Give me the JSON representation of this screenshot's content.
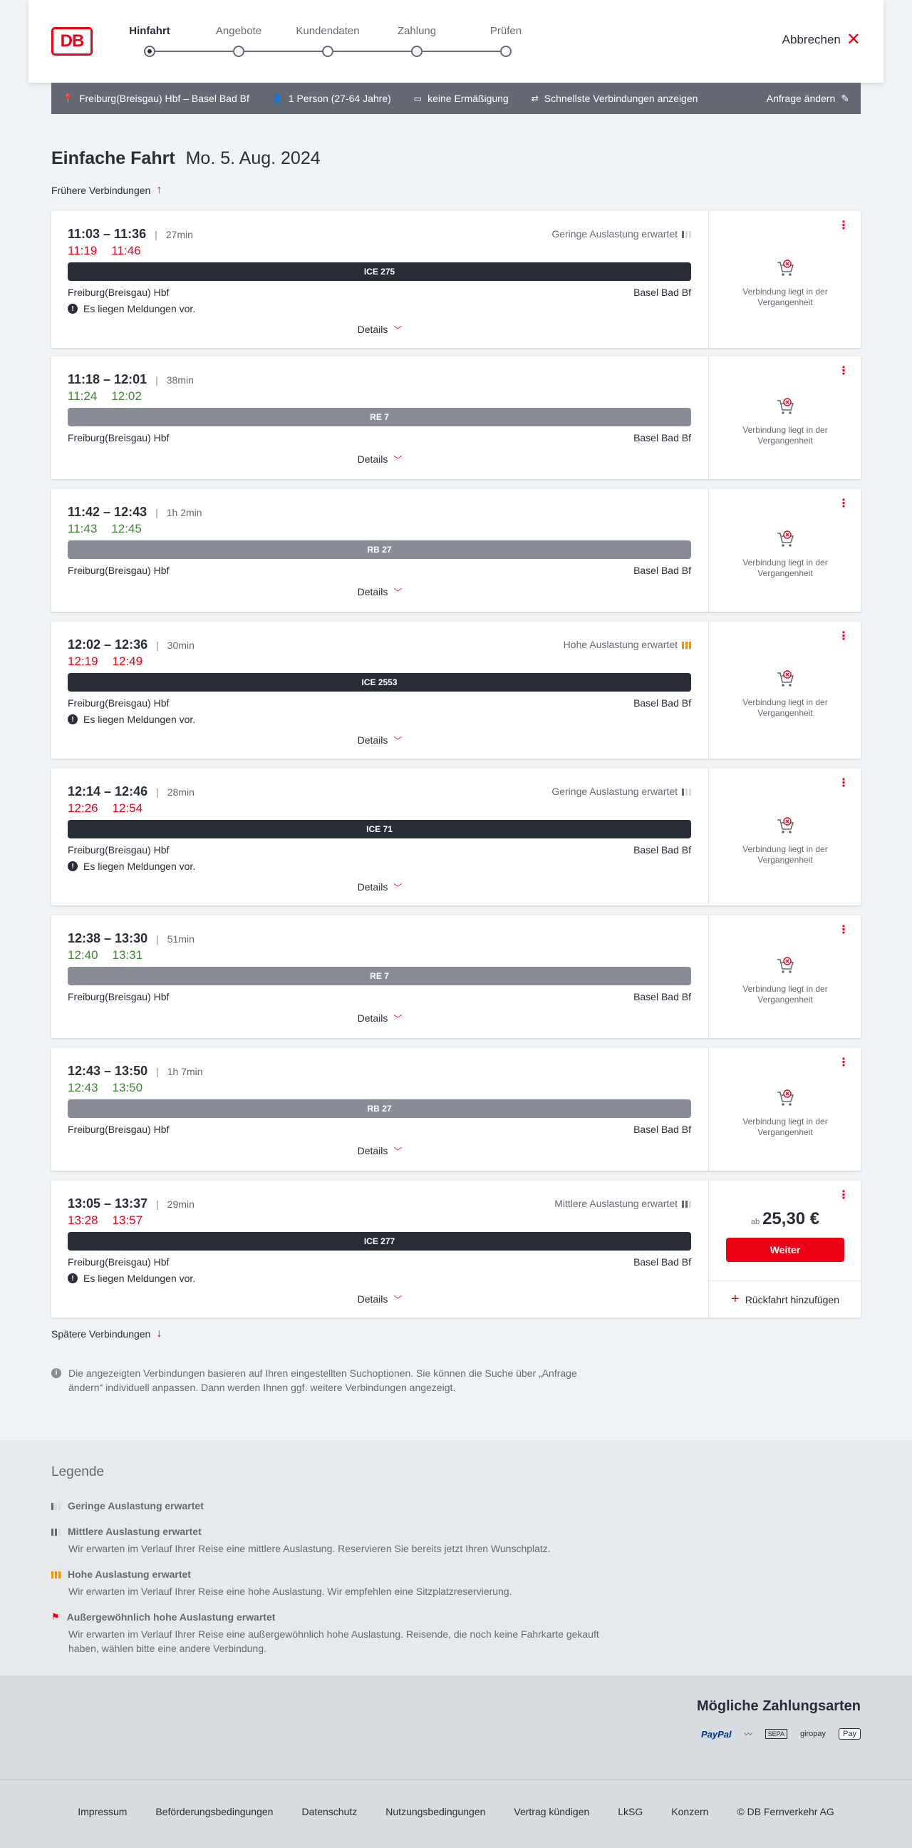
{
  "header": {
    "logo": "DB",
    "steps": [
      "Hinfahrt",
      "Angebote",
      "Kundendaten",
      "Zahlung",
      "Prüfen"
    ],
    "cancel": "Abbrechen"
  },
  "searchbar": {
    "route": "Freiburg(Breisgau) Hbf – Basel Bad Bf",
    "persons": "1 Person (27-64 Jahre)",
    "discount": "keine Ermäßigung",
    "fastest": "Schnellste Verbindungen anzeigen",
    "change": "Anfrage ändern"
  },
  "title": {
    "bold": "Einfache Fahrt",
    "date": "Mo. 5. Aug. 2024"
  },
  "earlier": "Frühere Verbindungen",
  "later": "Spätere Verbindungen",
  "details_label": "Details",
  "past_text_1": "Verbindung liegt in der",
  "past_text_2": "Vergangenheit",
  "messages_text": "Es liegen Meldungen vor.",
  "connections": [
    {
      "times": "11:03 – 11:36",
      "duration": "27min",
      "rt_dep": "11:19",
      "rt_arr": "11:46",
      "rt_state": "late",
      "load": "Geringe Auslastung erwartet",
      "load_level": "low",
      "train": "ICE 275",
      "type": "ice",
      "from": "Freiburg(Breisgau) Hbf",
      "to": "Basel Bad Bf",
      "messages": true
    },
    {
      "times": "11:18 – 12:01",
      "duration": "38min",
      "rt_dep": "11:24",
      "rt_arr": "12:02",
      "rt_state": "ontime",
      "load": "",
      "load_level": "",
      "train": "RE 7",
      "type": "reg",
      "from": "Freiburg(Breisgau) Hbf",
      "to": "Basel Bad Bf",
      "messages": false
    },
    {
      "times": "11:42 – 12:43",
      "duration": "1h 2min",
      "rt_dep": "11:43",
      "rt_arr": "12:45",
      "rt_state": "ontime",
      "load": "",
      "load_level": "",
      "train": "RB 27",
      "type": "reg",
      "from": "Freiburg(Breisgau) Hbf",
      "to": "Basel Bad Bf",
      "messages": false
    },
    {
      "times": "12:02 – 12:36",
      "duration": "30min",
      "rt_dep": "12:19",
      "rt_arr": "12:49",
      "rt_state": "late",
      "load": "Hohe Auslastung erwartet",
      "load_level": "high",
      "train": "ICE 2553",
      "type": "ice",
      "from": "Freiburg(Breisgau) Hbf",
      "to": "Basel Bad Bf",
      "messages": true
    },
    {
      "times": "12:14 – 12:46",
      "duration": "28min",
      "rt_dep": "12:26",
      "rt_arr": "12:54",
      "rt_state": "late",
      "load": "Geringe Auslastung erwartet",
      "load_level": "low",
      "train": "ICE 71",
      "type": "ice",
      "from": "Freiburg(Breisgau) Hbf",
      "to": "Basel Bad Bf",
      "messages": true
    },
    {
      "times": "12:38 – 13:30",
      "duration": "51min",
      "rt_dep": "12:40",
      "rt_arr": "13:31",
      "rt_state": "ontime",
      "load": "",
      "load_level": "",
      "train": "RE 7",
      "type": "reg",
      "from": "Freiburg(Breisgau) Hbf",
      "to": "Basel Bad Bf",
      "messages": false
    },
    {
      "times": "12:43 – 13:50",
      "duration": "1h 7min",
      "rt_dep": "12:43",
      "rt_arr": "13:50",
      "rt_state": "ontime",
      "load": "",
      "load_level": "",
      "train": "RB 27",
      "type": "reg",
      "from": "Freiburg(Breisgau) Hbf",
      "to": "Basel Bad Bf",
      "messages": false
    },
    {
      "times": "13:05 – 13:37",
      "duration": "29min",
      "rt_dep": "13:28",
      "rt_arr": "13:57",
      "rt_state": "late",
      "load": "Mittlere Auslastung erwartet",
      "load_level": "medium",
      "train": "ICE 277",
      "type": "ice",
      "from": "Freiburg(Breisgau) Hbf",
      "to": "Basel Bad Bf",
      "messages": true,
      "price_prefix": "ab",
      "price": "25,30 €",
      "button": "Weiter",
      "return_label": "Rückfahrt hinzufügen"
    }
  ],
  "info": "Die angezeigten Verbindungen basieren auf Ihren eingestellten Suchoptionen. Sie können die Suche über „Anfrage ändern“ individuell anpassen. Dann werden Ihnen ggf. weitere Verbindungen angezeigt.",
  "legend": {
    "title": "Legende",
    "items": [
      {
        "title": "Geringe Auslastung erwartet",
        "text": ""
      },
      {
        "title": "Mittlere Auslastung erwartet",
        "text": "Wir erwarten im Verlauf Ihrer Reise eine mittlere Auslastung. Reservieren Sie bereits jetzt Ihren Wunschplatz."
      },
      {
        "title": "Hohe Auslastung erwartet",
        "text": "Wir erwarten im Verlauf Ihrer Reise eine hohe Auslastung. Wir empfehlen eine Sitzplatzreservierung."
      },
      {
        "title": "Außergewöhnlich hohe Auslastung erwartet",
        "text": "Wir erwarten im Verlauf Ihrer Reise eine außergewöhnlich hohe Auslastung. Reisende, die noch keine Fahrkarte gekauft haben, wählen bitte eine andere Verbindung."
      }
    ]
  },
  "payment": {
    "title": "Mögliche Zahlungsarten",
    "methods": [
      "PayPal",
      "SEPA",
      "giropay",
      "Pay"
    ]
  },
  "footer": [
    "Impressum",
    "Beförderungsbedingungen",
    "Datenschutz",
    "Nutzungsbedingungen",
    "Vertrag kündigen",
    "LkSG",
    "Konzern",
    "© DB Fernverkehr AG"
  ],
  "colors": {
    "brand": "#ec0016",
    "ontime": "#408335",
    "late": "#ec0016",
    "highload": "#f39200"
  }
}
